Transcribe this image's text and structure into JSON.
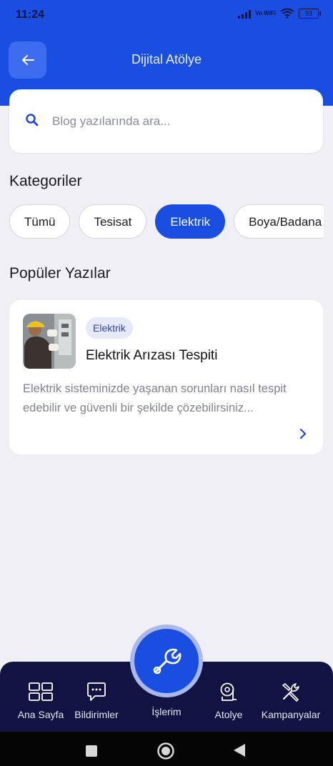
{
  "status": {
    "time": "11:24",
    "network": "Vo WiFi",
    "battery": "93"
  },
  "header": {
    "title": "Dijital Atölye"
  },
  "search": {
    "placeholder": "Blog yazılarında ara..."
  },
  "categories": {
    "title": "Kategoriler",
    "items": [
      {
        "label": "Tümü",
        "active": false
      },
      {
        "label": "Tesisat",
        "active": false
      },
      {
        "label": "Elektrik",
        "active": true
      },
      {
        "label": "Boya/Badana",
        "active": false
      }
    ]
  },
  "popular": {
    "title": "Popüler Yazılar",
    "posts": [
      {
        "tag": "Elektrik",
        "title": "Elektrik Arızası Tespiti",
        "excerpt": "Elektrik sisteminizde yaşanan sorunları nasıl tespit edebilir ve güvenli bir şekilde çözebilirsiniz..."
      }
    ]
  },
  "bottom_nav": {
    "items": [
      {
        "label": "Ana Sayfa",
        "icon": "grid-icon"
      },
      {
        "label": "Bildirimler",
        "icon": "chat-icon"
      },
      {
        "label": "İşlerim",
        "icon": "wrench-icon"
      },
      {
        "label": "Atolye",
        "icon": "tape-measure-icon"
      },
      {
        "label": "Kampanyalar",
        "icon": "tools-icon"
      }
    ]
  },
  "colors": {
    "primary": "#1a4ee0",
    "nav_bg": "#121342",
    "background": "#f0eff6"
  }
}
